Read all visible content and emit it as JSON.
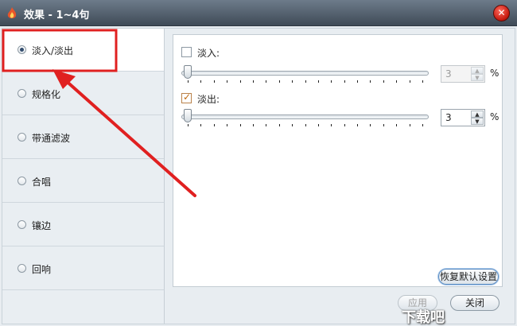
{
  "window": {
    "title": "效果 - 1~4句"
  },
  "sidebar": {
    "items": [
      {
        "label": "淡入/淡出",
        "selected": true
      },
      {
        "label": "规格化",
        "selected": false
      },
      {
        "label": "带通滤波",
        "selected": false
      },
      {
        "label": "合唱",
        "selected": false
      },
      {
        "label": "镶边",
        "selected": false
      },
      {
        "label": "回响",
        "selected": false
      }
    ]
  },
  "fade_in": {
    "label": "淡入:",
    "checked": false,
    "value": "3",
    "unit": "%",
    "slider_level": 0
  },
  "fade_out": {
    "label": "淡出:",
    "checked": true,
    "value": "3",
    "unit": "%",
    "slider_level": 0
  },
  "buttons": {
    "restore_label": "恢复默认设置",
    "apply_label": "应用",
    "close_label": "关闭"
  },
  "watermark": {
    "text": "下载吧"
  },
  "colors": {
    "annotation": "#e02020",
    "titlebar": "#4e5b68",
    "close": "#d4261b"
  }
}
